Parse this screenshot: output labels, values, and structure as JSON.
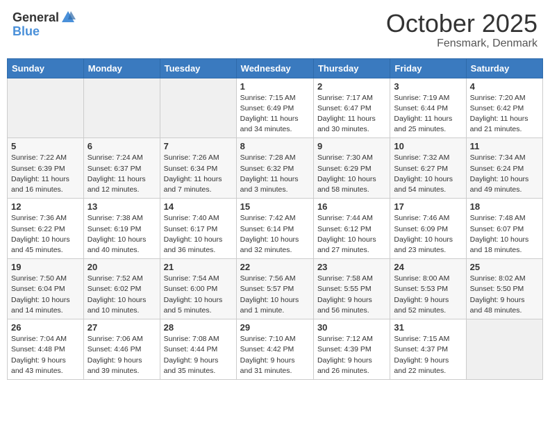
{
  "header": {
    "logo_general": "General",
    "logo_blue": "Blue",
    "month": "October 2025",
    "location": "Fensmark, Denmark"
  },
  "weekdays": [
    "Sunday",
    "Monday",
    "Tuesday",
    "Wednesday",
    "Thursday",
    "Friday",
    "Saturday"
  ],
  "weeks": [
    [
      {
        "day": "",
        "info": ""
      },
      {
        "day": "",
        "info": ""
      },
      {
        "day": "",
        "info": ""
      },
      {
        "day": "1",
        "info": "Sunrise: 7:15 AM\nSunset: 6:49 PM\nDaylight: 11 hours\nand 34 minutes."
      },
      {
        "day": "2",
        "info": "Sunrise: 7:17 AM\nSunset: 6:47 PM\nDaylight: 11 hours\nand 30 minutes."
      },
      {
        "day": "3",
        "info": "Sunrise: 7:19 AM\nSunset: 6:44 PM\nDaylight: 11 hours\nand 25 minutes."
      },
      {
        "day": "4",
        "info": "Sunrise: 7:20 AM\nSunset: 6:42 PM\nDaylight: 11 hours\nand 21 minutes."
      }
    ],
    [
      {
        "day": "5",
        "info": "Sunrise: 7:22 AM\nSunset: 6:39 PM\nDaylight: 11 hours\nand 16 minutes."
      },
      {
        "day": "6",
        "info": "Sunrise: 7:24 AM\nSunset: 6:37 PM\nDaylight: 11 hours\nand 12 minutes."
      },
      {
        "day": "7",
        "info": "Sunrise: 7:26 AM\nSunset: 6:34 PM\nDaylight: 11 hours\nand 7 minutes."
      },
      {
        "day": "8",
        "info": "Sunrise: 7:28 AM\nSunset: 6:32 PM\nDaylight: 11 hours\nand 3 minutes."
      },
      {
        "day": "9",
        "info": "Sunrise: 7:30 AM\nSunset: 6:29 PM\nDaylight: 10 hours\nand 58 minutes."
      },
      {
        "day": "10",
        "info": "Sunrise: 7:32 AM\nSunset: 6:27 PM\nDaylight: 10 hours\nand 54 minutes."
      },
      {
        "day": "11",
        "info": "Sunrise: 7:34 AM\nSunset: 6:24 PM\nDaylight: 10 hours\nand 49 minutes."
      }
    ],
    [
      {
        "day": "12",
        "info": "Sunrise: 7:36 AM\nSunset: 6:22 PM\nDaylight: 10 hours\nand 45 minutes."
      },
      {
        "day": "13",
        "info": "Sunrise: 7:38 AM\nSunset: 6:19 PM\nDaylight: 10 hours\nand 40 minutes."
      },
      {
        "day": "14",
        "info": "Sunrise: 7:40 AM\nSunset: 6:17 PM\nDaylight: 10 hours\nand 36 minutes."
      },
      {
        "day": "15",
        "info": "Sunrise: 7:42 AM\nSunset: 6:14 PM\nDaylight: 10 hours\nand 32 minutes."
      },
      {
        "day": "16",
        "info": "Sunrise: 7:44 AM\nSunset: 6:12 PM\nDaylight: 10 hours\nand 27 minutes."
      },
      {
        "day": "17",
        "info": "Sunrise: 7:46 AM\nSunset: 6:09 PM\nDaylight: 10 hours\nand 23 minutes."
      },
      {
        "day": "18",
        "info": "Sunrise: 7:48 AM\nSunset: 6:07 PM\nDaylight: 10 hours\nand 18 minutes."
      }
    ],
    [
      {
        "day": "19",
        "info": "Sunrise: 7:50 AM\nSunset: 6:04 PM\nDaylight: 10 hours\nand 14 minutes."
      },
      {
        "day": "20",
        "info": "Sunrise: 7:52 AM\nSunset: 6:02 PM\nDaylight: 10 hours\nand 10 minutes."
      },
      {
        "day": "21",
        "info": "Sunrise: 7:54 AM\nSunset: 6:00 PM\nDaylight: 10 hours\nand 5 minutes."
      },
      {
        "day": "22",
        "info": "Sunrise: 7:56 AM\nSunset: 5:57 PM\nDaylight: 10 hours\nand 1 minute."
      },
      {
        "day": "23",
        "info": "Sunrise: 7:58 AM\nSunset: 5:55 PM\nDaylight: 9 hours\nand 56 minutes."
      },
      {
        "day": "24",
        "info": "Sunrise: 8:00 AM\nSunset: 5:53 PM\nDaylight: 9 hours\nand 52 minutes."
      },
      {
        "day": "25",
        "info": "Sunrise: 8:02 AM\nSunset: 5:50 PM\nDaylight: 9 hours\nand 48 minutes."
      }
    ],
    [
      {
        "day": "26",
        "info": "Sunrise: 7:04 AM\nSunset: 4:48 PM\nDaylight: 9 hours\nand 43 minutes."
      },
      {
        "day": "27",
        "info": "Sunrise: 7:06 AM\nSunset: 4:46 PM\nDaylight: 9 hours\nand 39 minutes."
      },
      {
        "day": "28",
        "info": "Sunrise: 7:08 AM\nSunset: 4:44 PM\nDaylight: 9 hours\nand 35 minutes."
      },
      {
        "day": "29",
        "info": "Sunrise: 7:10 AM\nSunset: 4:42 PM\nDaylight: 9 hours\nand 31 minutes."
      },
      {
        "day": "30",
        "info": "Sunrise: 7:12 AM\nSunset: 4:39 PM\nDaylight: 9 hours\nand 26 minutes."
      },
      {
        "day": "31",
        "info": "Sunrise: 7:15 AM\nSunset: 4:37 PM\nDaylight: 9 hours\nand 22 minutes."
      },
      {
        "day": "",
        "info": ""
      }
    ]
  ]
}
